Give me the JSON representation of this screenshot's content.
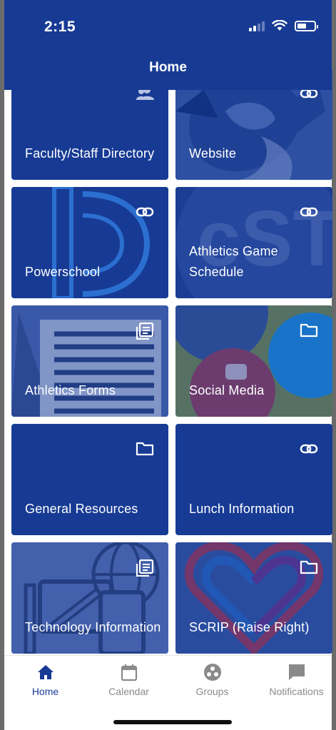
{
  "status_bar": {
    "time": "2:15"
  },
  "header": {
    "title": "Home"
  },
  "tiles": [
    {
      "label": "Faculty/Staff Directory",
      "icon": "people-icon"
    },
    {
      "label": "Website",
      "icon": "link-icon"
    },
    {
      "label": "Powerschool",
      "icon": "link-icon"
    },
    {
      "label": "Athletics Game Schedule",
      "icon": "link-icon"
    },
    {
      "label": "Athletics Forms",
      "icon": "document-icon"
    },
    {
      "label": "Social Media",
      "icon": "folder-icon"
    },
    {
      "label": "General Resources",
      "icon": "folder-icon"
    },
    {
      "label": "Lunch Information",
      "icon": "link-icon"
    },
    {
      "label": "Technology Information",
      "icon": "document-icon"
    },
    {
      "label": "SCRIP (Raise Right)",
      "icon": "folder-icon"
    }
  ],
  "bottom_nav": {
    "items": [
      {
        "label": "Home",
        "icon": "home-icon",
        "active": true
      },
      {
        "label": "Calendar",
        "icon": "calendar-icon",
        "active": false
      },
      {
        "label": "Groups",
        "icon": "groups-icon",
        "active": false
      },
      {
        "label": "Notifications",
        "icon": "chat-icon",
        "active": false
      }
    ]
  },
  "colors": {
    "brand": "#173b94",
    "inactive": "#8a8a8a"
  }
}
